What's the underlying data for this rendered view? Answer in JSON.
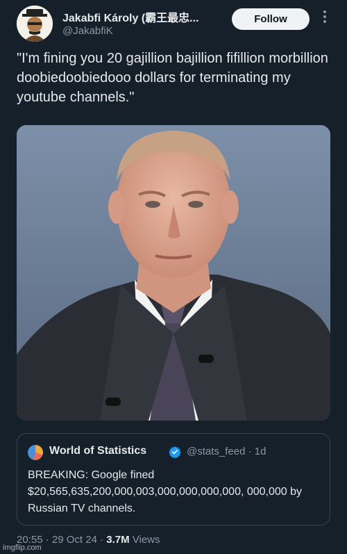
{
  "author": {
    "name": "Jakabfi Károly (霸王最忠...",
    "handle": "@JakabfiK"
  },
  "follow_label": "Follow",
  "more_icon": "more-vertical-icon",
  "tweet_text": "\"I'm fining you 20 gajillion bajillion fifillion morbillion doobiedoobiedooo dollars for terminating my youtube channels.\"",
  "quoted": {
    "name": "World of Statistics",
    "verified_icon": "verified-badge-icon",
    "handle_time": "@stats_feed · 1d",
    "text": "BREAKING: Google fined $20,565,635,200,000,003,000,000,000,000, 000,000 by Russian TV channels."
  },
  "meta": {
    "time_date": "20:55 · 29 Oct 24 · ",
    "views_count": "3.7M",
    "views_label": " Views"
  },
  "watermark": "imgflip.com",
  "colors": {
    "background": "#15202b",
    "text": "#e7e9ea",
    "muted": "#8b98a5",
    "verified": "#1d9bf0",
    "border": "#38444d"
  }
}
